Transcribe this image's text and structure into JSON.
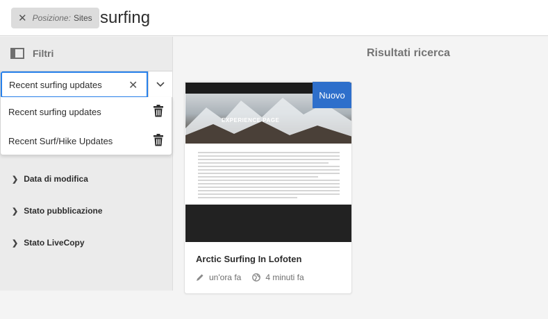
{
  "search": {
    "tag_label": "Posizione:",
    "tag_value": "Sites",
    "query": "surfing"
  },
  "filters": {
    "title": "Filtri",
    "saved_search_value": "Recent surfing updates",
    "saved_searches": [
      {
        "label": "Recent surfing updates"
      },
      {
        "label": "Recent Surf/Hike Updates"
      }
    ],
    "facets": [
      {
        "label": "Data di modifica"
      },
      {
        "label": "Stato pubblicazione"
      },
      {
        "label": "Stato LiveCopy"
      }
    ]
  },
  "results": {
    "title": "Risultati ricerca",
    "cards": [
      {
        "badge": "Nuovo",
        "title": "Arctic Surfing In Lofoten",
        "modified": "un'ora fa",
        "published": "4 minuti fa",
        "thumbnail_heading": "EXPERIENCE PAGE"
      }
    ]
  },
  "colors": {
    "accent": "#2680eb",
    "badge": "#2e6fcb"
  }
}
